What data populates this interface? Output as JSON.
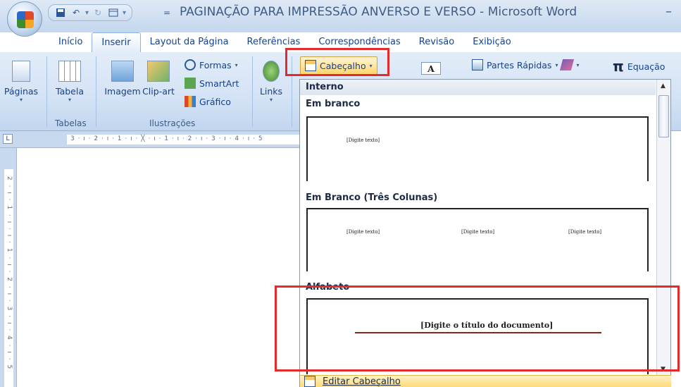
{
  "window": {
    "title": "PAGINAÇÃO PARA IMPRESSÃO ANVERSO E VERSO - Microsoft Word",
    "minimize": "–"
  },
  "quick_access": {
    "save_icon": "save-icon",
    "undo_icon": "undo-icon",
    "redo_icon": "redo-icon",
    "layout_icon": "layout-icon",
    "customize_glyph": "="
  },
  "tabs": [
    "Início",
    "Inserir",
    "Layout da Página",
    "Referências",
    "Correspondências",
    "Revisão",
    "Exibição"
  ],
  "active_tab": "Inserir",
  "ribbon": {
    "pages_label": "Páginas",
    "table_label": "Tabela",
    "tables_group": "Tabelas",
    "image_label": "Imagem",
    "clipart_label": "Clip-art",
    "shapes_label": "Formas",
    "smartart_label": "SmartArt",
    "chart_label": "Gráfico",
    "illustrations_group": "Ilustrações",
    "links_label": "Links",
    "header_button": "Cabeçalho",
    "quick_parts": "Partes Rápidas",
    "equation": "Equação"
  },
  "ruler": {
    "top_marks": "3 · ı · 2 · ı · 1 · ı · ╳ · ı · 1 · ı · 2 · ı · 3 · ı · 4 · ı · 5",
    "left_marks": "2 · ı · 1 · ı · ı · 1 · ı · 2 · ı · 3 · ı · 4 · ı · 5"
  },
  "gallery": {
    "category": "Interno",
    "sections": [
      {
        "title": "Em branco",
        "placeholders": [
          "[Digite texto]"
        ]
      },
      {
        "title": "Em Branco (Três Colunas)",
        "placeholders": [
          "[Digite texto]",
          "[Digite texto]",
          "[Digite texto]"
        ]
      },
      {
        "title": "Alfabeto",
        "placeholders": [
          "[Digite o título do documento]"
        ]
      }
    ],
    "edit_header": "Editar Cabeçalho"
  },
  "colors": {
    "highlight": "#e32b2b",
    "ribbon_text": "#15428b",
    "alphabet_rule": "#8b2323"
  }
}
